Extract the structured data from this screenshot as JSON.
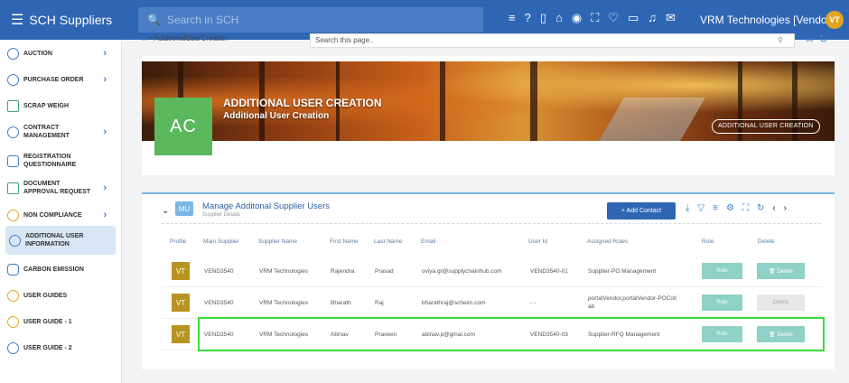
{
  "app": {
    "name": "SCH Suppliers",
    "search_placeholder": "Search in SCH",
    "org": "VRM Technologies  [Vendor ]",
    "avatar": "VT"
  },
  "topbar_icons": [
    "list-icon",
    "help-icon",
    "mobile-icon",
    "home-icon",
    "palette-icon",
    "expand-icon",
    "heart-icon",
    "chat-icon",
    "bell-icon",
    "mail-icon"
  ],
  "sidebar": {
    "items": [
      {
        "label": "AUCTION",
        "icon": "clock-icon",
        "chevron": true
      },
      {
        "label": "PURCHASE ORDER",
        "icon": "clock-icon",
        "chevron": true
      },
      {
        "label": "SCRAP WEIGH",
        "icon": "building-icon",
        "chevron": false
      },
      {
        "label": "CONTRACT MANAGEMENT",
        "icon": "clock-icon",
        "chevron": true
      },
      {
        "label": "REGISTRATION QUESTIONNAIRE",
        "icon": "users-icon",
        "chevron": false
      },
      {
        "label": "DOCUMENT APPROVAL REQUEST",
        "icon": "inbox-icon",
        "chevron": true
      },
      {
        "label": "NON COMPLIANCE",
        "icon": "clock-icon",
        "chevron": true
      },
      {
        "label": "ADDITIONAL USER INFORMATION",
        "icon": "clock-icon",
        "chevron": false,
        "active": true
      },
      {
        "label": "CARBON EMISSION",
        "icon": "user-icon",
        "chevron": false
      },
      {
        "label": "USER GUIDES",
        "icon": "help-icon",
        "chevron": false
      },
      {
        "label": "USER GUIDE - 1",
        "icon": "help-icon",
        "chevron": false
      },
      {
        "label": "USER GUIDE - 2",
        "icon": "help-icon",
        "chevron": false
      }
    ]
  },
  "breadcrumb": {
    "home": "⌂",
    "sep": ">",
    "page": "AdditionalUserCreation"
  },
  "page_search": {
    "placeholder": "Search this page.."
  },
  "banner": {
    "avatar": "AC",
    "title": "ADDITIONAL USER CREATION",
    "subtitle": "Additional User Creation",
    "badge": "ADDITIONAL USER CREATION"
  },
  "card": {
    "badge": "MU",
    "title": "Manage Additonal Supplier Users",
    "subtitle": "Supplier Details",
    "add_button": "+ Add Contact",
    "columns": [
      "Profile",
      "Main Supplier",
      "Supplier Name",
      "First Name",
      "Last Name",
      "Email",
      "User Id",
      "Assigned Roles",
      "Role",
      "Delete"
    ],
    "rows": [
      {
        "avatar": "VT",
        "main": "VEND3540",
        "supplier": "VRM Technologies",
        "first": "Rajendra",
        "last": "Prasad",
        "email": "oviya.gr@supplychainhub.com",
        "userid": "VEND3540-01",
        "roles": "Supplier-PO Management",
        "role_btn": "Role",
        "delete_btn": "🗑 Delete",
        "delete_disabled": false
      },
      {
        "avatar": "VT",
        "main": "VEND3540",
        "supplier": "VRM Technologies",
        "first": "Bharath",
        "last": "Raj",
        "email": "bharathraj@scheim.com",
        "userid": "- -",
        "roles": "portalVendor,portalVendor-POCollab",
        "role_btn": "Role",
        "delete_btn": "Delete",
        "delete_disabled": true
      },
      {
        "avatar": "VT",
        "main": "VEND3540",
        "supplier": "VRM Technologies",
        "first": "Abinav",
        "last": "Praveen",
        "email": "abinav.p@gmai.com",
        "userid": "VEND3540-03",
        "roles": "Supplier-RFQ Management",
        "role_btn": "Role",
        "delete_btn": "🗑 Delete",
        "delete_disabled": false
      }
    ]
  },
  "colors": {
    "primary": "#2f66b3",
    "avatar_bg": "#b8931f",
    "ac_bg": "#5cb85c",
    "teal_btn": "#8fd1c6",
    "highlight": "#3adb3a"
  }
}
